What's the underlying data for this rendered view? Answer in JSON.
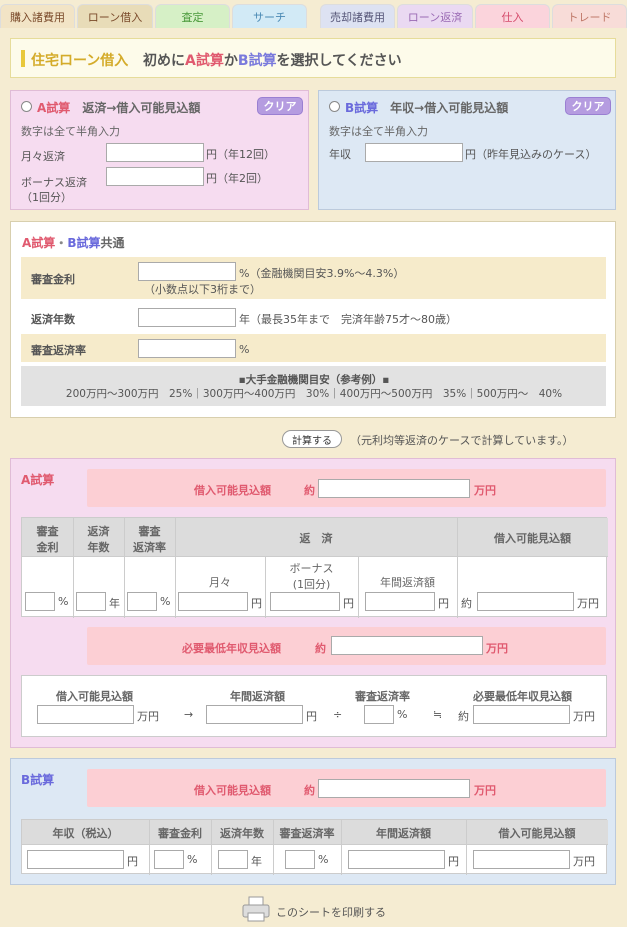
{
  "tabs": [
    {
      "label": "購入諸費用",
      "bg": "#f2e4c6",
      "color": "#7a4a2a"
    },
    {
      "label": "ローン借入",
      "bg": "#e8dcb8",
      "color": "#7a4a2a"
    },
    {
      "label": "査定",
      "bg": "#d6f0c6",
      "color": "#4a9a3a"
    },
    {
      "label": "サーチ",
      "bg": "#d2eaf6",
      "color": "#4a8ab4"
    },
    {
      "label": "売却諸費用",
      "bg": "#dde2f2",
      "color": "#555577"
    },
    {
      "label": "ローン返済",
      "bg": "#ead9f2",
      "color": "#9a6ab4"
    },
    {
      "label": "仕入",
      "bg": "#fbd4dc",
      "color": "#d44a6a"
    },
    {
      "label": "トレード",
      "bg": "#f8dcd8",
      "color": "#c07a6a"
    }
  ],
  "header": {
    "title": "住宅ローン借入",
    "text_1": "初めに",
    "a_label": "A試算",
    "text_2": "か",
    "b_label": "B試算",
    "text_3": "を選択してください"
  },
  "a_box": {
    "title_a": "A試算",
    "title_rest": "返済→借入可能見込額",
    "clear": "クリア",
    "note": "数字は全て半角入力",
    "monthly_label": "月々返済",
    "monthly_unit": "円（年12回）",
    "bonus_label": "ボーナス返済",
    "bonus_label_2": "（1回分）",
    "bonus_unit": "円（年2回）"
  },
  "b_box": {
    "title_b": "B試算",
    "title_rest": "年収→借入可能見込額",
    "clear": "クリア",
    "note": "数字は全て半角入力",
    "income_label": "年収",
    "income_unit": "円（昨年見込みのケース）"
  },
  "common": {
    "title_a": "A試算",
    "dot": "・",
    "title_b": "B試算",
    "title_rest": "共通",
    "rate_label": "審査金利",
    "rate_unit": "%（金融機関目安3.9%〜4.3%）",
    "rate_note": "（小数点以下3桁まで）",
    "years_label": "返済年数",
    "years_unit": "年（最長35年まで　完済年齢75才〜80歳）",
    "ratio_label": "審査返済率",
    "ratio_unit": "%",
    "ref_title": "▪大手金融機関目安（参考例）▪",
    "ref_text": "200万円〜300万円　25%｜300万円〜400万円　30%｜400万円〜500万円　35%｜500万円〜　40%"
  },
  "calc": {
    "button": "計算する",
    "note": "（元利均等返済のケースで計算しています。）"
  },
  "a_result": {
    "title": "A試算",
    "loan_label": "借入可能見込額",
    "approx": "約",
    "man_yen": "万円",
    "headers": {
      "rate": "審査",
      "rate2": "金利",
      "years": "返済",
      "years2": "年数",
      "ratio": "審査",
      "ratio2": "返済率",
      "repay": "返　済",
      "loan": "借入可能見込額"
    },
    "sub_headers": {
      "monthly": "月々",
      "bonus": "ボーナス",
      "bonus2": "(1回分)",
      "annual": "年間返済額"
    },
    "units": {
      "pct": "%",
      "year": "年",
      "yen": "円",
      "approx": "約",
      "man_yen": "万円"
    },
    "min_income_label": "必要最低年収見込額",
    "min_approx": "約",
    "min_man_yen": "万円",
    "formula": {
      "loan": "借入可能見込額",
      "annual": "年間返済額",
      "ratio": "審査返済率",
      "income": "必要最低年収見込額",
      "man_yen": "万円",
      "arrow": "→",
      "yen": "円",
      "div": "÷",
      "pct": "%",
      "approx_eq": "≒",
      "approx": "約",
      "man_yen2": "万円"
    }
  },
  "b_result": {
    "title": "B試算",
    "loan_label": "借入可能見込額",
    "approx": "約",
    "man_yen": "万円",
    "headers": {
      "income": "年収（税込）",
      "rate": "審査金利",
      "years": "返済年数",
      "ratio": "審査返済率",
      "annual": "年間返済額",
      "loan": "借入可能見込額"
    },
    "units": {
      "yen": "円",
      "pct": "%",
      "year": "年",
      "yen2": "円",
      "man_yen": "万円"
    }
  },
  "print": {
    "label": "このシートを印刷する"
  }
}
